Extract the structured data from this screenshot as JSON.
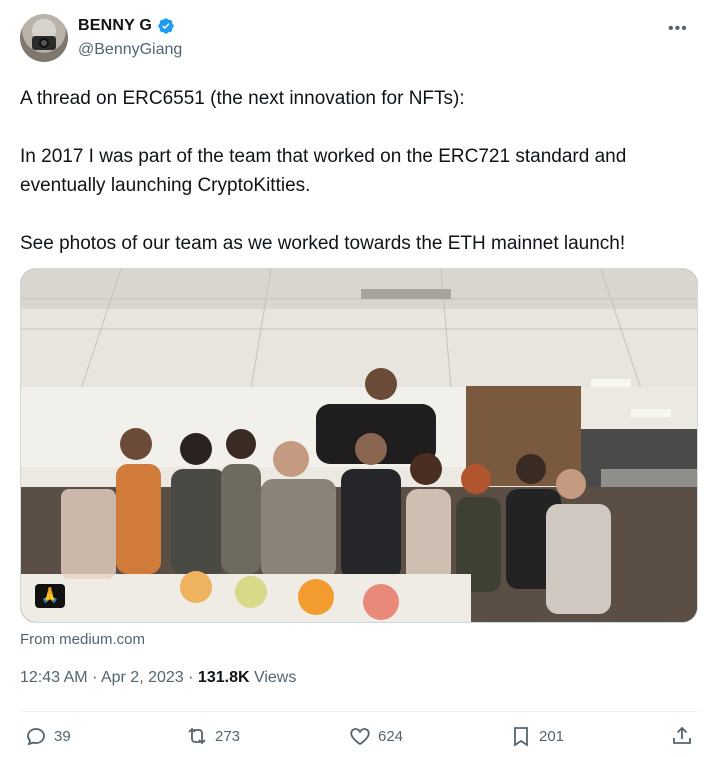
{
  "author": {
    "display_name": "BENNY G",
    "handle": "@BennyGiang",
    "verified": true
  },
  "tweet": {
    "lines": [
      "A thread on ERC6551 (the next innovation for NFTs):",
      "In 2017 I was part of the team that worked on the ERC721 standard and eventually launching CryptoKitties.",
      "See photos of our team as we worked towards the ETH mainnet launch!"
    ]
  },
  "media": {
    "alt_badge_icon": "folded-hands-emoji"
  },
  "source": "From medium.com",
  "meta": {
    "time": "12:43 AM",
    "date": "Apr 2, 2023",
    "views_count": "131.8K",
    "views_label": "Views"
  },
  "actions": {
    "replies": "39",
    "reposts": "273",
    "likes": "624",
    "bookmarks": "201"
  },
  "colors": {
    "verified": "#1d9bf0",
    "secondary_text": "#536471",
    "primary_text": "#0f1419"
  },
  "icons": [
    "verified-icon",
    "more-icon",
    "reply-icon",
    "repost-icon",
    "like-icon",
    "bookmark-icon",
    "share-icon"
  ]
}
